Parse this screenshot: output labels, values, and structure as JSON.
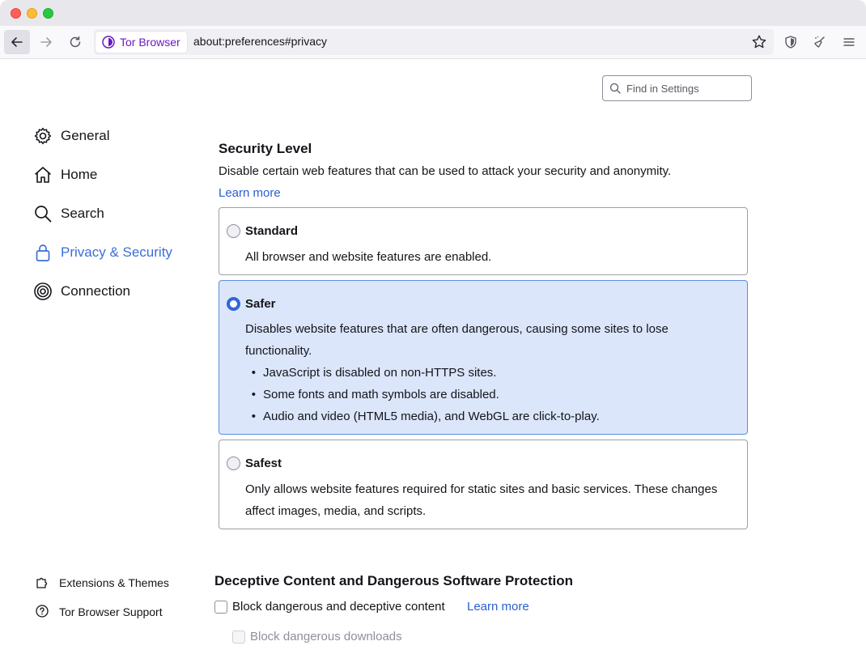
{
  "browser": {
    "identity_label": "Tor Browser",
    "url": "about:preferences#privacy"
  },
  "search": {
    "placeholder": "Find in Settings"
  },
  "sidebar": {
    "items": [
      {
        "label": "General",
        "icon": "gear-icon"
      },
      {
        "label": "Home",
        "icon": "home-icon"
      },
      {
        "label": "Search",
        "icon": "search-icon"
      },
      {
        "label": "Privacy & Security",
        "icon": "lock-icon",
        "selected": true
      },
      {
        "label": "Connection",
        "icon": "onion-icon"
      }
    ],
    "footer": [
      {
        "label": "Extensions & Themes",
        "icon": "puzzle-icon"
      },
      {
        "label": "Tor Browser Support",
        "icon": "help-icon"
      }
    ]
  },
  "security_level": {
    "title": "Security Level",
    "description": "Disable certain web features that can be used to attack your security and anonymity.",
    "learn_more": "Learn more",
    "options": [
      {
        "title": "Standard",
        "text": "All browser and website features are enabled.",
        "selected": false
      },
      {
        "title": "Safer",
        "text": "Disables website features that are often dangerous, causing some sites to lose functionality.",
        "bullets": [
          "JavaScript is disabled on non-HTTPS sites.",
          "Some fonts and math symbols are disabled.",
          "Audio and video (HTML5 media), and WebGL are click-to-play."
        ],
        "selected": true
      },
      {
        "title": "Safest",
        "text": "Only allows website features required for static sites and basic services. These changes affect images, media, and scripts.",
        "selected": false
      }
    ]
  },
  "deceptive": {
    "title": "Deceptive Content and Dangerous Software Protection",
    "block_content_label": "Block dangerous and deceptive content",
    "learn_more": "Learn more",
    "block_downloads_label": "Block dangerous downloads"
  },
  "colors": {
    "accent": "#3366d6",
    "selected_card_bg": "#dbe6fb",
    "tor_purple": "#6b19c2"
  }
}
